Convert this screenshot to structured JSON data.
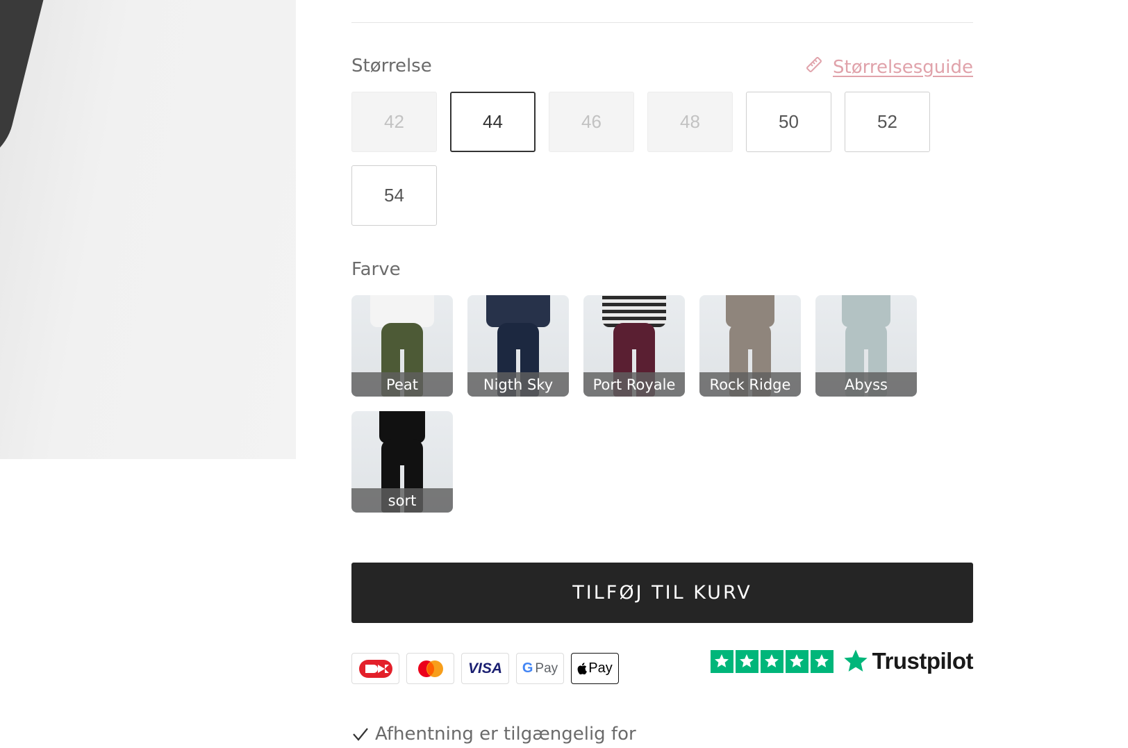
{
  "size": {
    "label": "Størrelse",
    "guide_label": "Størrelsesguide",
    "options": [
      {
        "value": "42",
        "state": "unavailable"
      },
      {
        "value": "44",
        "state": "selected"
      },
      {
        "value": "46",
        "state": "unavailable"
      },
      {
        "value": "48",
        "state": "unavailable"
      },
      {
        "value": "50",
        "state": "available"
      },
      {
        "value": "52",
        "state": "available"
      },
      {
        "value": "54",
        "state": "available"
      }
    ]
  },
  "color": {
    "label": "Farve",
    "options": [
      {
        "name": "Peat",
        "pant_color": "#4d5a36",
        "top_color": "#f4f4f4"
      },
      {
        "name": "Nigth Sky",
        "pant_color": "#1c2840",
        "top_color": "#27324a"
      },
      {
        "name": "Port Royale",
        "pant_color": "#5a1f32",
        "top_color": "#3b3b3b"
      },
      {
        "name": "Rock Ridge",
        "pant_color": "#8f857c",
        "top_color": "#8f857c"
      },
      {
        "name": "Abyss",
        "pant_color": "#b3c2c3",
        "top_color": "#b3c2c3"
      },
      {
        "name": "sort",
        "pant_color": "#111111",
        "top_color": "#111111"
      }
    ]
  },
  "cart": {
    "button_label": "TILFØJ TIL KURV"
  },
  "payments": [
    {
      "icon": "dankort-icon"
    },
    {
      "icon": "mastercard-icon"
    },
    {
      "icon": "visa-icon",
      "text": "VISA"
    },
    {
      "icon": "google-pay-icon",
      "text": "Pay"
    },
    {
      "icon": "apple-pay-icon",
      "text": "Pay"
    }
  ],
  "trustpilot": {
    "label": "Trustpilot",
    "stars": 5,
    "color": "#00b67a"
  },
  "pickup": {
    "text": "Afhentning er tilgængelig for"
  },
  "colors": {
    "accent_link": "#e0a2aa",
    "button_bg": "#252525"
  }
}
